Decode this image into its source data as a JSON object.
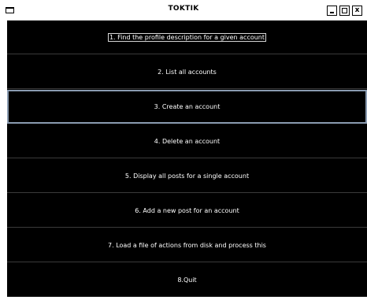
{
  "window": {
    "title": "TOKTIK",
    "minimize_label": "",
    "maximize_label": "",
    "close_label": "x"
  },
  "menu": {
    "items": [
      {
        "label": "1. Find the profile description for a given account"
      },
      {
        "label": "2. List all accounts"
      },
      {
        "label": "3. Create an account"
      },
      {
        "label": "4. Delete an account"
      },
      {
        "label": "5. Display all posts for a single account"
      },
      {
        "label": "6. Add a new post for an account"
      },
      {
        "label": "7. Load a file of actions from disk and process this"
      },
      {
        "label": "8.Quit"
      }
    ]
  },
  "colors": {
    "menu_background": "#000000",
    "menu_text": "#ffffff",
    "selected_border": "#8a9bb0"
  },
  "icons": {
    "window_icon": "window-icon",
    "minimize": "minimize-icon",
    "maximize": "maximize-icon",
    "close": "close-icon"
  }
}
